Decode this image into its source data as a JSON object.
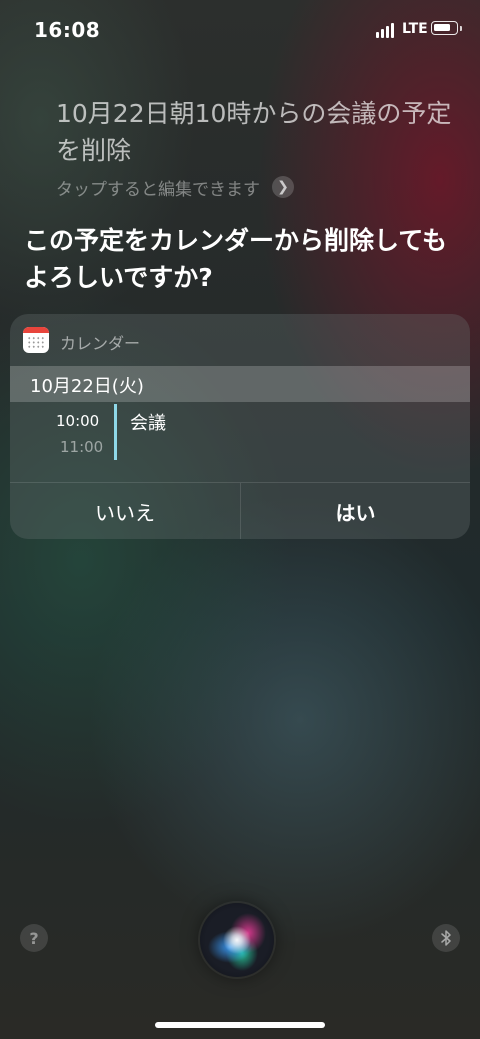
{
  "status_bar": {
    "time": "16:08",
    "network": "LTE",
    "icons": [
      "signal-icon",
      "battery-icon"
    ]
  },
  "siri": {
    "query": "10月22日朝10時からの会議の予定を削除",
    "edit_hint": "タップすると編集できます",
    "response": "この予定をカレンダーから削除してもよろしいですか?"
  },
  "card": {
    "app_name": "カレンダー",
    "date": "10月22日(火)",
    "event": {
      "start": "10:00",
      "end": "11:00",
      "title": "会議",
      "accent_color": "#8fd8e8"
    },
    "buttons": {
      "no": "いいえ",
      "yes": "はい"
    }
  },
  "bottom": {
    "help_label": "?",
    "icons": [
      "help-icon",
      "siri-orb-icon",
      "bluetooth-icon"
    ]
  }
}
